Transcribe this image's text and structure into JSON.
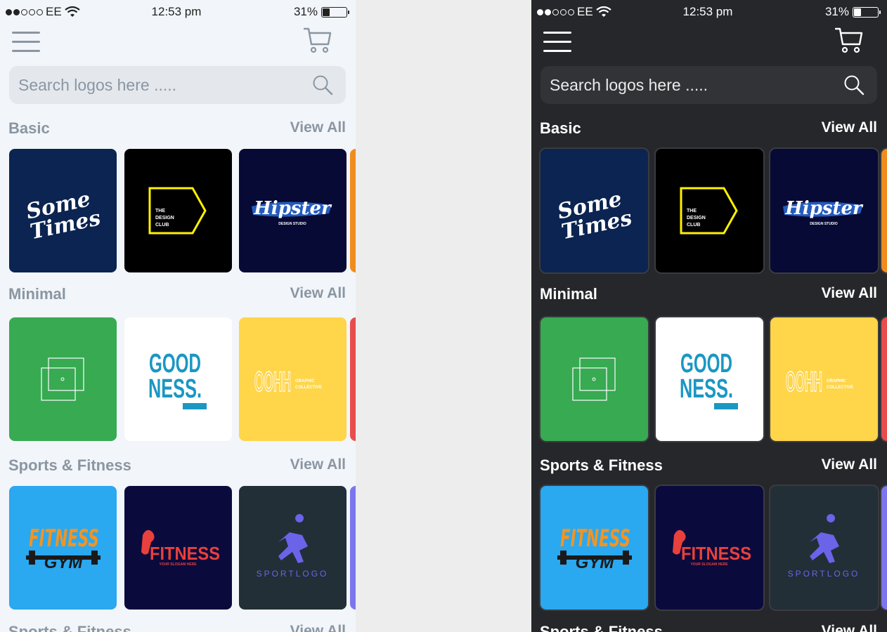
{
  "status_bar": {
    "carrier": "EE",
    "time": "12:53 pm",
    "battery": "31%",
    "battery_level": 0.31
  },
  "header": {
    "menu_icon": "hamburger-menu-icon",
    "cart_icon": "shopping-cart-icon"
  },
  "search": {
    "placeholder": "Search logos here .....",
    "icon": "search-icon"
  },
  "sections": [
    {
      "title": "Basic",
      "view_all": "View All",
      "tiles": [
        {
          "name": "sometimes-logo",
          "text": [
            "Some",
            "Times"
          ],
          "bg": "#0b2451"
        },
        {
          "name": "the-design-club-logo",
          "text": [
            "THE",
            "DESIGN",
            "CLUB"
          ],
          "bg": "#000000"
        },
        {
          "name": "hipster-logo",
          "text": [
            "Hipster",
            "DESIGN STUDIO"
          ],
          "bg": "#070a35"
        }
      ],
      "peek_color": "#f08c1e"
    },
    {
      "title": "Minimal",
      "view_all": "View All",
      "tiles": [
        {
          "name": "squares-logo",
          "text": [],
          "bg": "#37aa52"
        },
        {
          "name": "goodness-logo",
          "text": [
            "GOOD",
            "NESS."
          ],
          "bg": "#ffffff"
        },
        {
          "name": "oohh-logo",
          "text": [
            "OOHH",
            "GRAPHIC",
            "COLLECTIVE"
          ],
          "bg": "#ffd54a"
        }
      ],
      "peek_color": "#e84d4d"
    },
    {
      "title": "Sports & Fitness",
      "view_all": "View All",
      "tiles": [
        {
          "name": "fitness-gym-logo",
          "text": [
            "FITNESS",
            "GYM"
          ],
          "bg": "#2aa8f0"
        },
        {
          "name": "fitness-slogan-logo",
          "text": [
            "FITNESS",
            "YOUR SLOGAM HERE"
          ],
          "bg": "#0b0a3c"
        },
        {
          "name": "sportlogo-logo",
          "text": [
            "SPORTLOGO"
          ],
          "bg": "#222f37"
        }
      ],
      "peek_color": "#7b76ee"
    },
    {
      "title": "Sports & Fitness",
      "view_all": "View All"
    }
  ]
}
